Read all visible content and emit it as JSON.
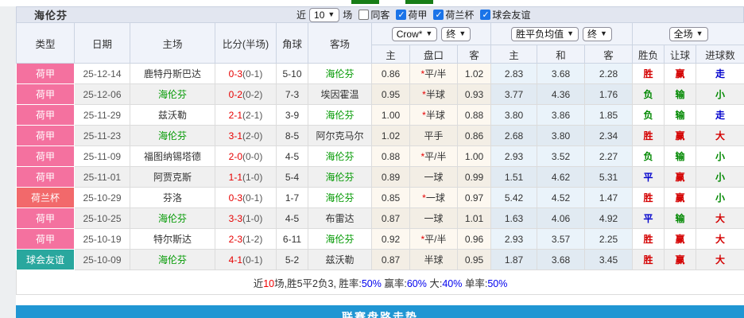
{
  "page": {
    "title_bar": {
      "title": "海伦芬"
    },
    "filters": {
      "recent_label": "近",
      "recent_count": "10",
      "unit_label": "场",
      "same_opponent_label": "同客",
      "same_opponent_checked": false,
      "leagues": [
        {
          "label": "荷甲",
          "checked": true
        },
        {
          "label": "荷兰杯",
          "checked": true
        },
        {
          "label": "球会友谊",
          "checked": true
        }
      ]
    },
    "table": {
      "static_columns": [
        "类型",
        "日期",
        "主场",
        "比分(半场)",
        "角球",
        "客场"
      ],
      "odds_columns": [
        "主",
        "盘口",
        "客",
        "主",
        "和",
        "客",
        "胜负",
        "让球",
        "进球数"
      ],
      "dropdowns": {
        "bookmaker": "Crow*",
        "bookmaker_stage": "终",
        "europe_odds": "胜平负均值",
        "europe_stage": "终",
        "scope": "全场"
      },
      "rows": [
        {
          "type": "荷甲",
          "type_style": "league",
          "date": "25-12-14",
          "home": "鹿特丹斯巴达",
          "home_highlight": false,
          "score": "0-3",
          "half": "(0-1)",
          "corner": "5-10",
          "away": "海伦芬",
          "away_highlight": true,
          "ah_home": "0.86",
          "ah_star": true,
          "ah_line": "平/半",
          "ah_away": "1.02",
          "eu_home": "2.83",
          "eu_draw": "3.68",
          "eu_away": "2.28",
          "result": {
            "text": "胜",
            "color": "red"
          },
          "handicap": {
            "text": "赢",
            "color": "red"
          },
          "goals": {
            "text": "走",
            "color": "blue"
          }
        },
        {
          "type": "荷甲",
          "type_style": "league",
          "date": "25-12-06",
          "home": "海伦芬",
          "home_highlight": true,
          "score": "0-2",
          "half": "(0-2)",
          "corner": "7-3",
          "away": "埃因霍温",
          "away_highlight": false,
          "ah_home": "0.95",
          "ah_star": true,
          "ah_line": "半球",
          "ah_away": "0.93",
          "eu_home": "3.77",
          "eu_draw": "4.36",
          "eu_away": "1.76",
          "result": {
            "text": "负",
            "color": "green"
          },
          "handicap": {
            "text": "输",
            "color": "green"
          },
          "goals": {
            "text": "小",
            "color": "green"
          }
        },
        {
          "type": "荷甲",
          "type_style": "league",
          "date": "25-11-29",
          "home": "兹沃勒",
          "home_highlight": false,
          "score": "2-1",
          "half": "(2-1)",
          "corner": "3-9",
          "away": "海伦芬",
          "away_highlight": true,
          "ah_home": "1.00",
          "ah_star": true,
          "ah_line": "半球",
          "ah_away": "0.88",
          "eu_home": "3.80",
          "eu_draw": "3.86",
          "eu_away": "1.85",
          "result": {
            "text": "负",
            "color": "green"
          },
          "handicap": {
            "text": "输",
            "color": "green"
          },
          "goals": {
            "text": "走",
            "color": "blue"
          }
        },
        {
          "type": "荷甲",
          "type_style": "league",
          "date": "25-11-23",
          "home": "海伦芬",
          "home_highlight": true,
          "score": "3-1",
          "half": "(2-0)",
          "corner": "8-5",
          "away": "阿尔克马尔",
          "away_highlight": false,
          "ah_home": "1.02",
          "ah_star": false,
          "ah_line": "平手",
          "ah_away": "0.86",
          "eu_home": "2.68",
          "eu_draw": "3.80",
          "eu_away": "2.34",
          "result": {
            "text": "胜",
            "color": "red"
          },
          "handicap": {
            "text": "赢",
            "color": "red"
          },
          "goals": {
            "text": "大",
            "color": "red"
          }
        },
        {
          "type": "荷甲",
          "type_style": "league",
          "date": "25-11-09",
          "home": "福图纳锡塔德",
          "home_highlight": false,
          "score": "2-0",
          "half": "(0-0)",
          "corner": "4-5",
          "away": "海伦芬",
          "away_highlight": true,
          "ah_home": "0.88",
          "ah_star": true,
          "ah_line": "平/半",
          "ah_away": "1.00",
          "eu_home": "2.93",
          "eu_draw": "3.52",
          "eu_away": "2.27",
          "result": {
            "text": "负",
            "color": "green"
          },
          "handicap": {
            "text": "输",
            "color": "green"
          },
          "goals": {
            "text": "小",
            "color": "green"
          }
        },
        {
          "type": "荷甲",
          "type_style": "league",
          "date": "25-11-01",
          "home": "阿贾克斯",
          "home_highlight": false,
          "score": "1-1",
          "half": "(1-0)",
          "corner": "5-4",
          "away": "海伦芬",
          "away_highlight": true,
          "ah_home": "0.89",
          "ah_star": false,
          "ah_line": "一球",
          "ah_away": "0.99",
          "eu_home": "1.51",
          "eu_draw": "4.62",
          "eu_away": "5.31",
          "result": {
            "text": "平",
            "color": "blue"
          },
          "handicap": {
            "text": "赢",
            "color": "red"
          },
          "goals": {
            "text": "小",
            "color": "green"
          }
        },
        {
          "type": "荷兰杯",
          "type_style": "cup",
          "date": "25-10-29",
          "home": "芬洛",
          "home_highlight": false,
          "score": "0-3",
          "half": "(0-1)",
          "corner": "1-7",
          "away": "海伦芬",
          "away_highlight": true,
          "ah_home": "0.85",
          "ah_star": true,
          "ah_line": "一球",
          "ah_away": "0.97",
          "eu_home": "5.42",
          "eu_draw": "4.52",
          "eu_away": "1.47",
          "result": {
            "text": "胜",
            "color": "red"
          },
          "handicap": {
            "text": "赢",
            "color": "red"
          },
          "goals": {
            "text": "小",
            "color": "green"
          }
        },
        {
          "type": "荷甲",
          "type_style": "league",
          "date": "25-10-25",
          "home": "海伦芬",
          "home_highlight": true,
          "score": "3-3",
          "half": "(1-0)",
          "corner": "4-5",
          "away": "布雷达",
          "away_highlight": false,
          "ah_home": "0.87",
          "ah_star": false,
          "ah_line": "一球",
          "ah_away": "1.01",
          "eu_home": "1.63",
          "eu_draw": "4.06",
          "eu_away": "4.92",
          "result": {
            "text": "平",
            "color": "blue"
          },
          "handicap": {
            "text": "输",
            "color": "green"
          },
          "goals": {
            "text": "大",
            "color": "red"
          }
        },
        {
          "type": "荷甲",
          "type_style": "league",
          "date": "25-10-19",
          "home": "特尔斯达",
          "home_highlight": false,
          "score": "2-3",
          "half": "(1-2)",
          "corner": "6-11",
          "away": "海伦芬",
          "away_highlight": true,
          "ah_home": "0.92",
          "ah_star": true,
          "ah_line": "平/半",
          "ah_away": "0.96",
          "eu_home": "2.93",
          "eu_draw": "3.57",
          "eu_away": "2.25",
          "result": {
            "text": "胜",
            "color": "red"
          },
          "handicap": {
            "text": "赢",
            "color": "red"
          },
          "goals": {
            "text": "大",
            "color": "red"
          }
        },
        {
          "type": "球会友谊",
          "type_style": "friendly",
          "date": "25-10-09",
          "home": "海伦芬",
          "home_highlight": true,
          "score": "4-1",
          "half": "(0-1)",
          "corner": "5-2",
          "away": "兹沃勒",
          "away_highlight": false,
          "ah_home": "0.87",
          "ah_star": false,
          "ah_line": "半球",
          "ah_away": "0.95",
          "eu_home": "1.87",
          "eu_draw": "3.68",
          "eu_away": "3.45",
          "result": {
            "text": "胜",
            "color": "red"
          },
          "handicap": {
            "text": "赢",
            "color": "red"
          },
          "goals": {
            "text": "大",
            "color": "red"
          }
        }
      ]
    },
    "summary_segments": [
      {
        "text": "近",
        "color": "black"
      },
      {
        "text": "10",
        "color": "red"
      },
      {
        "text": "场,胜5平2负3, 胜率:",
        "color": "black"
      },
      {
        "text": "50%",
        "color": "blue"
      },
      {
        "text": " 赢率:",
        "color": "black"
      },
      {
        "text": "60%",
        "color": "blue"
      },
      {
        "text": " 大:",
        "color": "black"
      },
      {
        "text": "40%",
        "color": "blue"
      },
      {
        "text": " 单率:",
        "color": "black"
      },
      {
        "text": "50%",
        "color": "blue"
      }
    ],
    "bottom_bar_label": "联赛盘路走势",
    "colors": {
      "league_pink": "#f4719f",
      "cup_red": "#f2696b",
      "friendly_teal": "#29a79e",
      "team_highlight_green": "#009900",
      "bottom_bar_blue": "#2096d3"
    }
  }
}
